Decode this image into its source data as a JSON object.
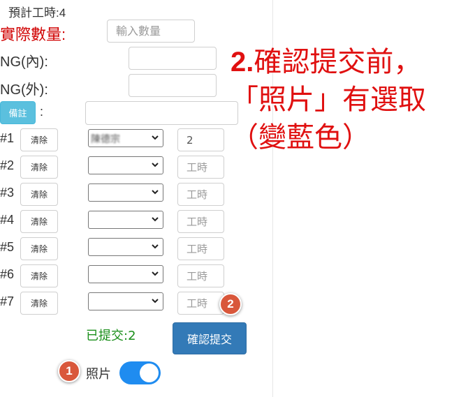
{
  "header": {
    "estimated_hours": "預計工時:4"
  },
  "form": {
    "actual_qty_label": "實際數量:",
    "qty_placeholder": "輸入數量",
    "ng_in_label": "NG(內):",
    "ng_out_label": "NG(外):",
    "remark_button": "備註",
    "remark_colon": ":"
  },
  "workers": {
    "clear_label": "清除",
    "hours_placeholder": "工時",
    "rows": [
      {
        "label": "#1",
        "worker": "陳德宗",
        "hours": "2"
      },
      {
        "label": "#2",
        "worker": "",
        "hours": ""
      },
      {
        "label": "#3",
        "worker": "",
        "hours": ""
      },
      {
        "label": "#4",
        "worker": "",
        "hours": ""
      },
      {
        "label": "#5",
        "worker": "",
        "hours": ""
      },
      {
        "label": "#6",
        "worker": "",
        "hours": ""
      },
      {
        "label": "#7",
        "worker": "",
        "hours": ""
      }
    ]
  },
  "footer": {
    "submitted": "已提交:2",
    "confirm_button": "確認提交",
    "photo_label": "照片",
    "photo_toggle_on": true
  },
  "annotations": {
    "marker_1": "1",
    "marker_2": "2",
    "note_number": "2.",
    "note_line1": "確認提交前，",
    "note_line2": "「照片」有選取",
    "note_line3": "（變藍色）"
  },
  "colors": {
    "accent_red": "#e01010",
    "toggle_blue": "#1f8cf0",
    "primary_button": "#337ab7",
    "info_button": "#5bc0de",
    "marker": "#d9573b",
    "submitted_green": "#1a8f1a"
  }
}
